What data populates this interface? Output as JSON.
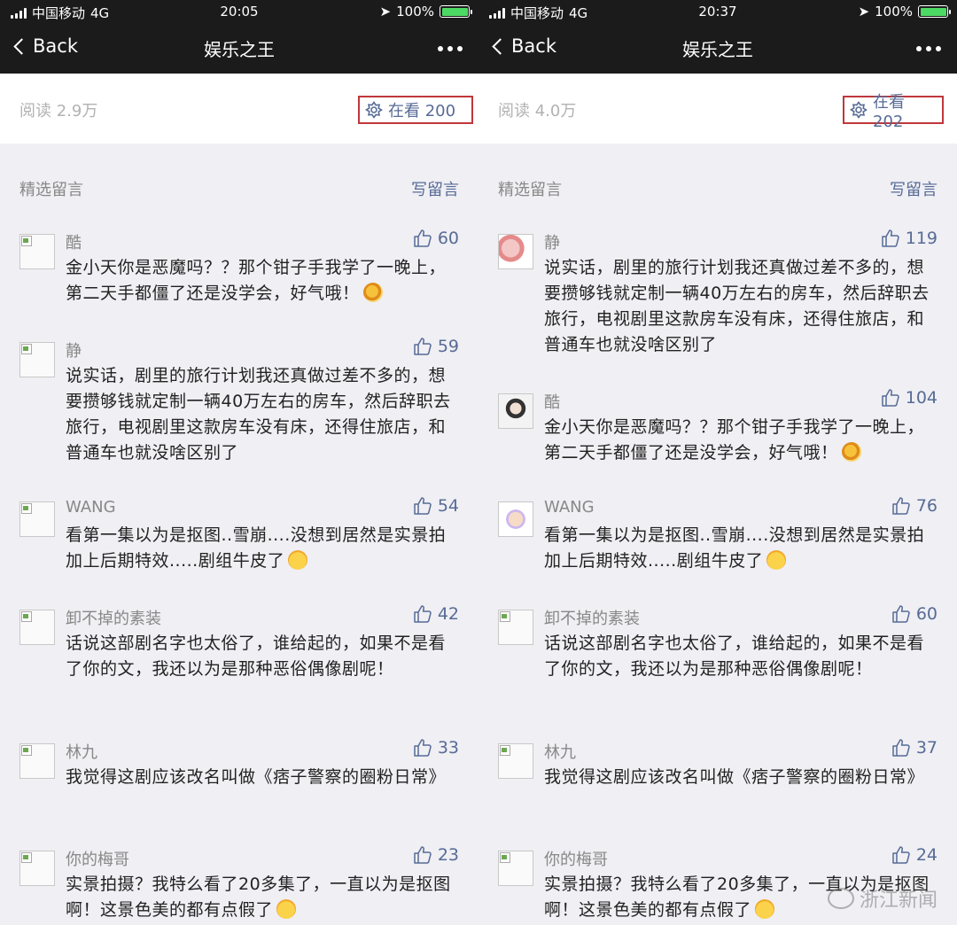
{
  "panels": [
    {
      "status": {
        "carrier": "中国移动",
        "network": "4G",
        "time": "20:05",
        "battery": "100%"
      },
      "nav": {
        "back": "Back",
        "title": "娱乐之王"
      },
      "info": {
        "reads": "阅读 2.9万",
        "watching": "在看 200"
      },
      "section": {
        "label": "精选留言",
        "write": "写留言"
      },
      "comments": [
        {
          "name": "酷",
          "likes": "60",
          "text": "金小天你是恶魔吗？？那个钳子手我学了一晚上，第二天手都僵了还是没学会，好气哦！",
          "emoji": "snail-emoji"
        },
        {
          "name": "静",
          "likes": "59",
          "text": "说实话，剧里的旅行计划我还真做过差不多的，想要攒够钱就定制一辆40万左右的房车，然后辞职去旅行，电视剧里这款房车没有床，还得住旅店，和普通车也就没啥区别了",
          "emoji": ""
        },
        {
          "name": "WANG",
          "likes": "54",
          "text": "看第一集以为是抠图..雪崩....没想到居然是实景拍加上后期特效.....剧组牛皮了",
          "emoji": "laugh-emoji"
        },
        {
          "name": "卸不掉的素装",
          "likes": "42",
          "text": "话说这部剧名字也太俗了，谁给起的，如果不是看了你的文，我还以为是那种恶俗偶像剧呢！",
          "emoji": ""
        },
        {
          "name": "林九",
          "likes": "33",
          "text": "我觉得这剧应该改名叫做《痞子警察的圈粉日常》",
          "emoji": ""
        },
        {
          "name": "你的梅哥",
          "likes": "23",
          "text": "实景拍摄？我特么看了20多集了，一直以为是抠图啊！这景色美的都有点假了",
          "emoji": "shocked-emoji"
        }
      ]
    },
    {
      "status": {
        "carrier": "中国移动",
        "network": "4G",
        "time": "20:37",
        "battery": "100%"
      },
      "nav": {
        "back": "Back",
        "title": "娱乐之王"
      },
      "info": {
        "reads": "阅读 4.0万",
        "watching": "在看 202"
      },
      "section": {
        "label": "精选留言",
        "write": "写留言"
      },
      "comments": [
        {
          "name": "静",
          "likes": "119",
          "text": "说实话，剧里的旅行计划我还真做过差不多的，想要攒够钱就定制一辆40万左右的房车，然后辞职去旅行，电视剧里这款房车没有床，还得住旅店，和普通车也就没啥区别了",
          "emoji": ""
        },
        {
          "name": "酷",
          "likes": "104",
          "text": "金小天你是恶魔吗？？那个钳子手我学了一晚上，第二天手都僵了还是没学会，好气哦！",
          "emoji": "snail-emoji"
        },
        {
          "name": "WANG",
          "likes": "76",
          "text": "看第一集以为是抠图..雪崩....没想到居然是实景拍加上后期特效.....剧组牛皮了",
          "emoji": "laugh-emoji"
        },
        {
          "name": "卸不掉的素装",
          "likes": "60",
          "text": "话说这部剧名字也太俗了，谁给起的，如果不是看了你的文，我还以为是那种恶俗偶像剧呢！",
          "emoji": ""
        },
        {
          "name": "林九",
          "likes": "37",
          "text": "我觉得这剧应该改名叫做《痞子警察的圈粉日常》",
          "emoji": ""
        },
        {
          "name": "你的梅哥",
          "likes": "24",
          "text": "实景拍摄？我特么看了20多集了，一直以为是抠图啊！这景色美的都有点假了",
          "emoji": "shocked-emoji"
        }
      ],
      "watermark": "浙江新闻"
    }
  ],
  "colors": {
    "link": "#576b95",
    "highlight_box": "#c0373b",
    "bar": "#1b1b1b",
    "battery": "#4cd964"
  }
}
